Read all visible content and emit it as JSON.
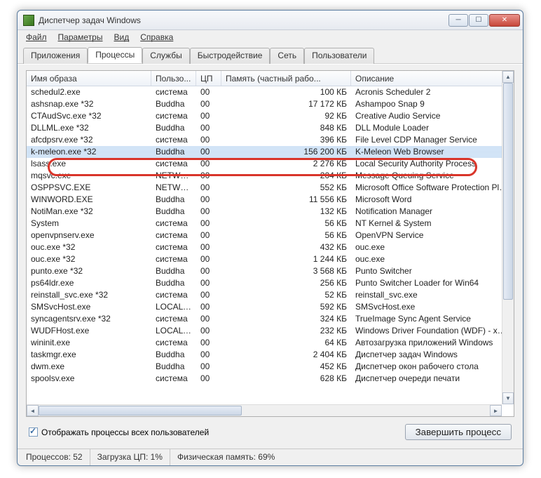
{
  "window": {
    "title": "Диспетчер задач Windows"
  },
  "menus": [
    "Файл",
    "Параметры",
    "Вид",
    "Справка"
  ],
  "tabs": [
    "Приложения",
    "Процессы",
    "Службы",
    "Быстродействие",
    "Сеть",
    "Пользователи"
  ],
  "activeTab": 1,
  "columns": [
    "Имя образа",
    "Пользо...",
    "ЦП",
    "Память (частный рабо...",
    "Описание"
  ],
  "rows": [
    {
      "name": "schedul2.exe",
      "user": "система",
      "cpu": "00",
      "mem": "100 КБ",
      "desc": "Acronis Scheduler 2"
    },
    {
      "name": "ashsnap.exe *32",
      "user": "Buddha",
      "cpu": "00",
      "mem": "17 172 КБ",
      "desc": "Ashampoo Snap 9"
    },
    {
      "name": "CTAudSvc.exe *32",
      "user": "система",
      "cpu": "00",
      "mem": "92 КБ",
      "desc": "Creative Audio Service"
    },
    {
      "name": "DLLML.exe *32",
      "user": "Buddha",
      "cpu": "00",
      "mem": "848 КБ",
      "desc": "DLL Module Loader"
    },
    {
      "name": "afcdpsrv.exe *32",
      "user": "система",
      "cpu": "00",
      "mem": "396 КБ",
      "desc": "File Level CDP Manager Service"
    },
    {
      "name": "k-meleon.exe *32",
      "user": "Buddha",
      "cpu": "00",
      "mem": "156 200 КБ",
      "desc": "K-Meleon Web Browser",
      "selected": true
    },
    {
      "name": "lsass.exe",
      "user": "система",
      "cpu": "00",
      "mem": "2 276 КБ",
      "desc": "Local Security Authority Process"
    },
    {
      "name": "mqsvc.exe",
      "user": "NETWO...",
      "cpu": "00",
      "mem": "204 КБ",
      "desc": "Message Queuing Service"
    },
    {
      "name": "OSPPSVC.EXE",
      "user": "NETWO...",
      "cpu": "00",
      "mem": "552 КБ",
      "desc": "Microsoft Office Software Protection Platform S"
    },
    {
      "name": "WINWORD.EXE",
      "user": "Buddha",
      "cpu": "00",
      "mem": "11 556 КБ",
      "desc": "Microsoft Word"
    },
    {
      "name": "NotiMan.exe *32",
      "user": "Buddha",
      "cpu": "00",
      "mem": "132 КБ",
      "desc": "Notification Manager"
    },
    {
      "name": "System",
      "user": "система",
      "cpu": "00",
      "mem": "56 КБ",
      "desc": "NT Kernel & System"
    },
    {
      "name": "openvpnserv.exe",
      "user": "система",
      "cpu": "00",
      "mem": "56 КБ",
      "desc": "OpenVPN Service"
    },
    {
      "name": "ouc.exe *32",
      "user": "система",
      "cpu": "00",
      "mem": "432 КБ",
      "desc": "ouc.exe"
    },
    {
      "name": "ouc.exe *32",
      "user": "система",
      "cpu": "00",
      "mem": "1 244 КБ",
      "desc": "ouc.exe"
    },
    {
      "name": "punto.exe *32",
      "user": "Buddha",
      "cpu": "00",
      "mem": "3 568 КБ",
      "desc": "Punto Switcher"
    },
    {
      "name": "ps64ldr.exe",
      "user": "Buddha",
      "cpu": "00",
      "mem": "256 КБ",
      "desc": "Punto Switcher Loader for Win64"
    },
    {
      "name": "reinstall_svc.exe *32",
      "user": "система",
      "cpu": "00",
      "mem": "52 КБ",
      "desc": "reinstall_svc.exe"
    },
    {
      "name": "SMSvcHost.exe",
      "user": "LOCAL ...",
      "cpu": "00",
      "mem": "592 КБ",
      "desc": "SMSvcHost.exe"
    },
    {
      "name": "syncagentsrv.exe *32",
      "user": "система",
      "cpu": "00",
      "mem": "324 КБ",
      "desc": "TrueImage Sync Agent Service"
    },
    {
      "name": "WUDFHost.exe",
      "user": "LOCAL ...",
      "cpu": "00",
      "mem": "232 КБ",
      "desc": "Windows Driver Foundation (WDF) - хост-проц"
    },
    {
      "name": "wininit.exe",
      "user": "система",
      "cpu": "00",
      "mem": "64 КБ",
      "desc": "Автозагрузка приложений Windows"
    },
    {
      "name": "taskmgr.exe",
      "user": "Buddha",
      "cpu": "00",
      "mem": "2 404 КБ",
      "desc": "Диспетчер задач Windows"
    },
    {
      "name": "dwm.exe",
      "user": "Buddha",
      "cpu": "00",
      "mem": "452 КБ",
      "desc": "Диспетчер окон рабочего стола"
    },
    {
      "name": "spoolsv.exe",
      "user": "система",
      "cpu": "00",
      "mem": "628 КБ",
      "desc": "Диспетчер очереди печати"
    }
  ],
  "checkbox": {
    "label": "Отображать процессы всех пользователей",
    "checked": true
  },
  "button": {
    "endProcess": "Завершить процесс"
  },
  "status": {
    "processes": "Процессов: 52",
    "cpu": "Загрузка ЦП: 1%",
    "memory": "Физическая память: 69%"
  }
}
